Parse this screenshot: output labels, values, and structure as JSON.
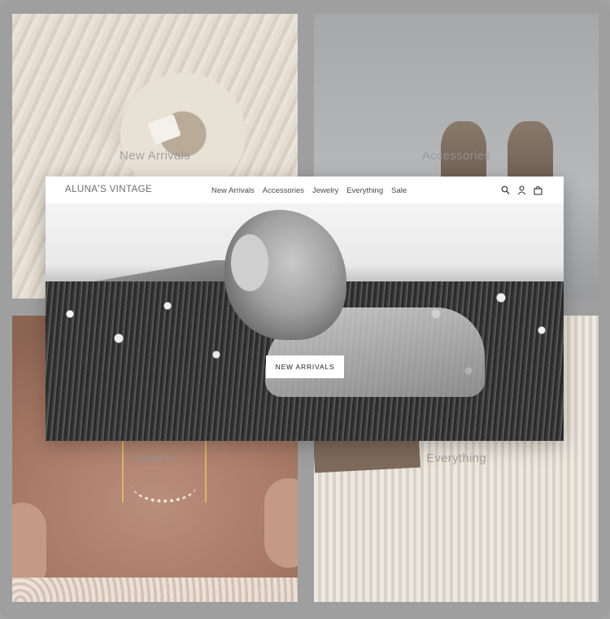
{
  "tiles": [
    {
      "label": "New Arrivals",
      "image": "cream sweater with collar tag"
    },
    {
      "label": "Accessories",
      "image": "brown cowboy boots"
    },
    {
      "label": "Jewelry",
      "image": "gold necklace on chest"
    },
    {
      "label": "Everything",
      "image": "cream cable knit cardigan"
    }
  ],
  "site": {
    "logo": "ALUNA'S VINTAGE",
    "nav": [
      "New Arrivals",
      "Accessories",
      "Jewelry",
      "Everything",
      "Sale"
    ],
    "icons": [
      "search-icon",
      "account-icon",
      "cart-icon"
    ],
    "hero": {
      "image": "black and white woman lying in flower field",
      "button": "NEW ARRIVALS"
    }
  }
}
